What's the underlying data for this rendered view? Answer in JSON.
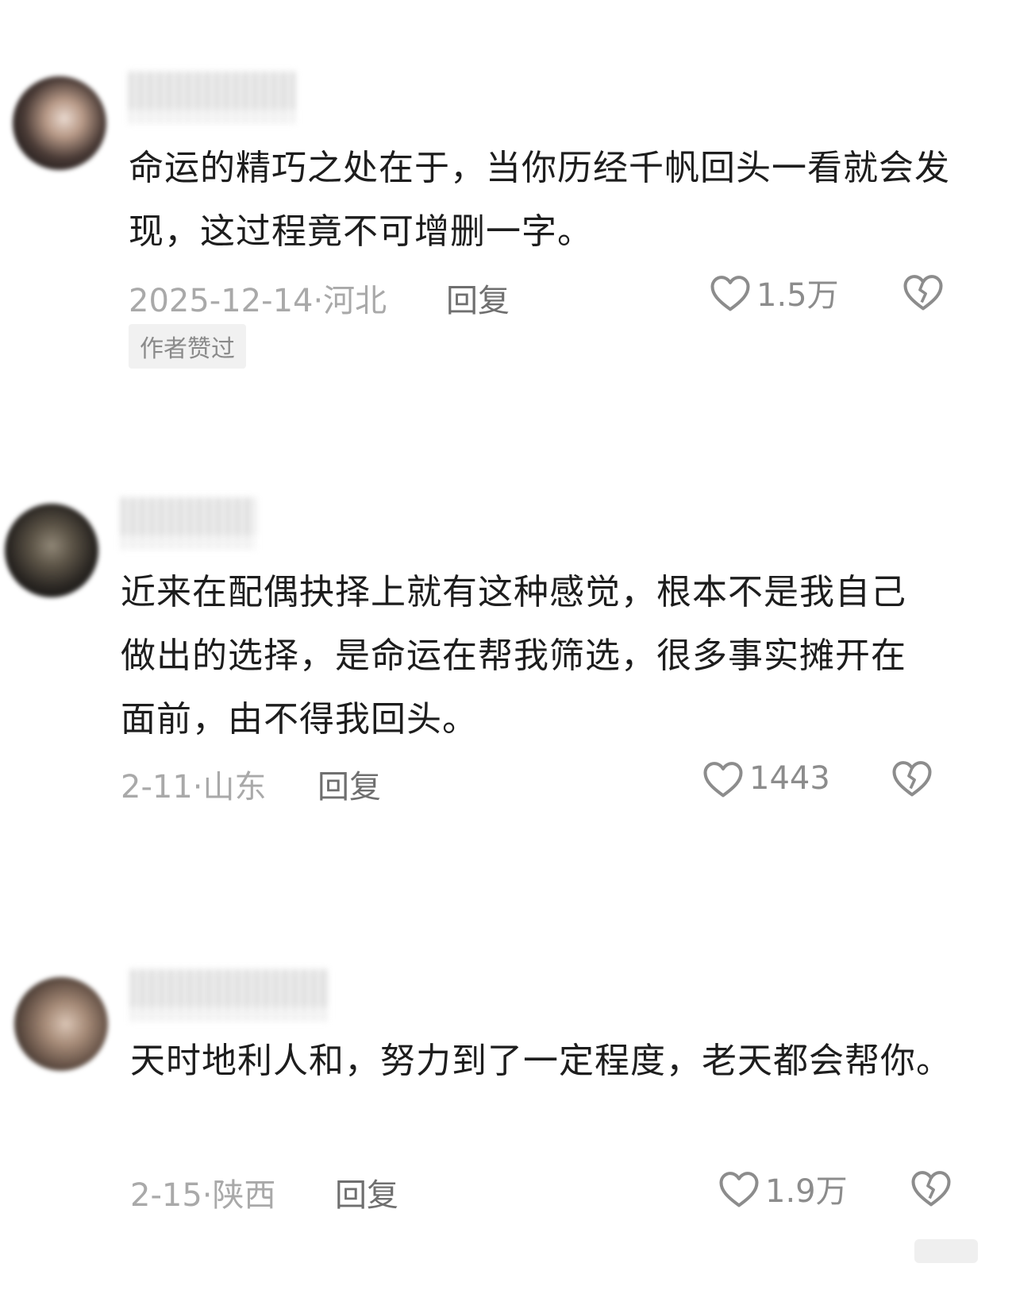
{
  "comments": [
    {
      "text": "命运的精巧之处在于，当你历经千帆回头一看就会发现，这过程竟不可增删一字。",
      "date_location": "2025-12-14·河北",
      "reply_label": "回复",
      "like_count": "1.5万",
      "badge": "作者赞过"
    },
    {
      "text": "近来在配偶抉择上就有这种感觉，根本不是我自己做出的选择，是命运在帮我筛选，很多事实摊开在面前，由不得我回头。",
      "date_location": "2-11·山东",
      "reply_label": "回复",
      "like_count": "1443"
    },
    {
      "text": "天时地利人和，努力到了一定程度，老天都会帮你。",
      "date_location": "2-15·陕西",
      "reply_label": "回复",
      "like_count": "1.9万"
    }
  ],
  "icons": {
    "like": "heart-outline-icon",
    "dislike": "broken-heart-icon"
  },
  "colors": {
    "text": "#1d1d1d",
    "meta": "#a9a9a9",
    "reply": "#6f6f6f",
    "badge_bg": "#f1f1f1"
  }
}
